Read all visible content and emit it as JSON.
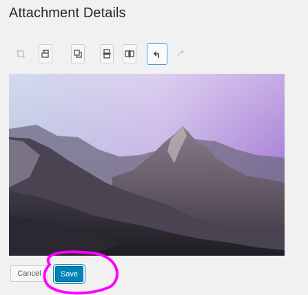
{
  "header": {
    "title": "Attachment Details"
  },
  "toolbar": {
    "buttons": [
      {
        "name": "crop",
        "icon": "crop-icon",
        "state": "disabled"
      },
      {
        "name": "rotate-left",
        "icon": "rotate-left-icon",
        "state": "normal"
      },
      {
        "name": "rotate-right",
        "icon": "rotate-right-icon",
        "state": "normal"
      },
      {
        "name": "flip-vertical",
        "icon": "flip-vertical-icon",
        "state": "normal"
      },
      {
        "name": "flip-horizontal",
        "icon": "flip-horizontal-icon",
        "state": "normal"
      },
      {
        "name": "undo",
        "icon": "undo-icon",
        "state": "active"
      },
      {
        "name": "redo",
        "icon": "redo-icon",
        "state": "disabled"
      }
    ]
  },
  "actions": {
    "cancel_label": "Cancel",
    "save_label": "Save"
  },
  "colors": {
    "accent": "#0085ba",
    "annotation": "#ff00ff"
  }
}
